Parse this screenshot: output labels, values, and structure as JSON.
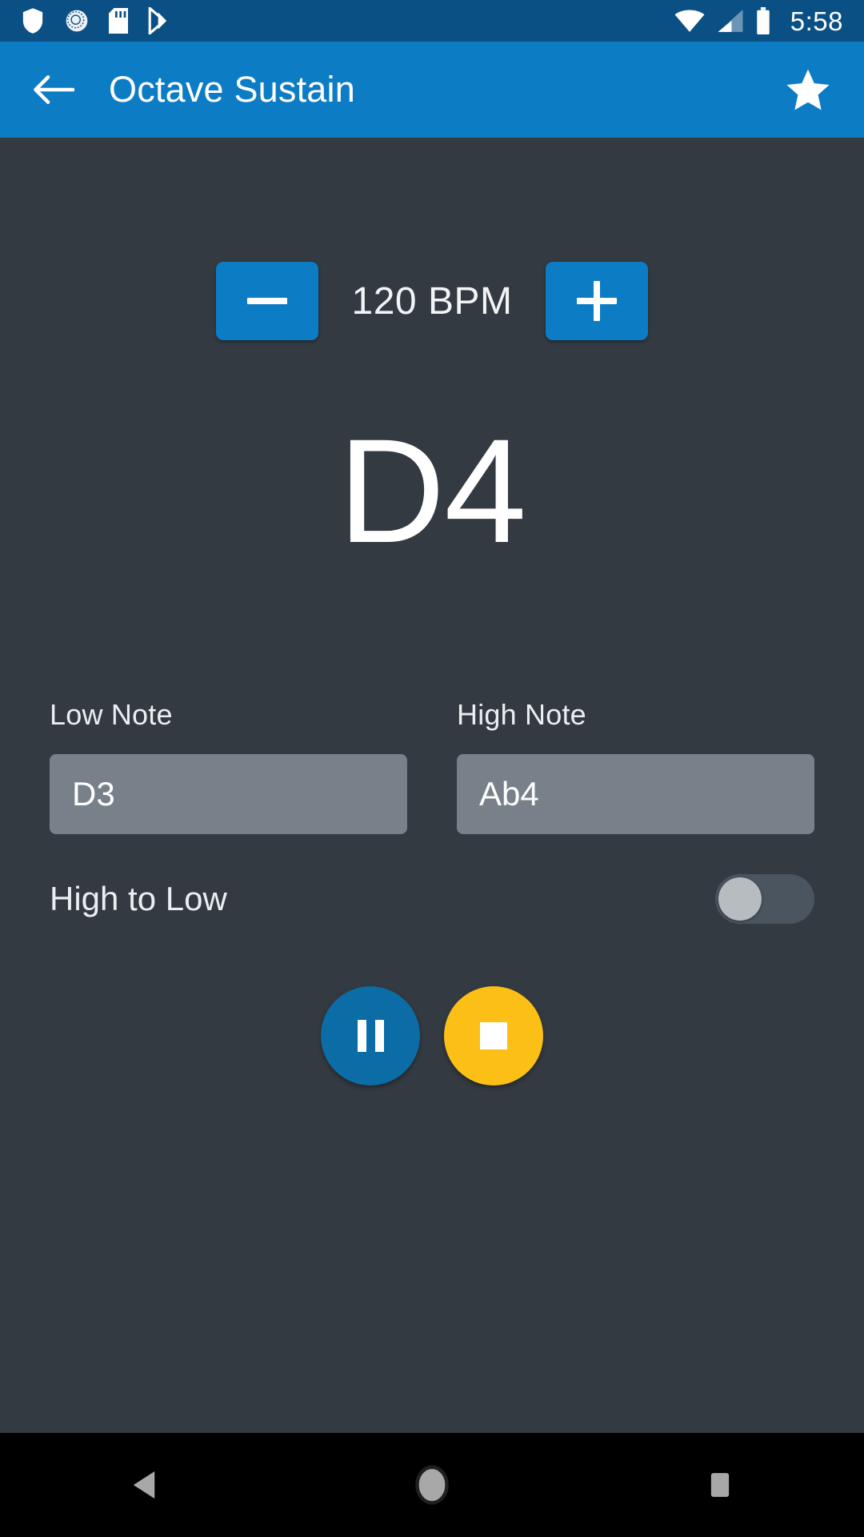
{
  "status_bar": {
    "background": "#0b5084",
    "time": "5:58",
    "icons": [
      {
        "name": "shield-icon"
      },
      {
        "name": "sync-circle-icon"
      },
      {
        "name": "sd-card-icon"
      },
      {
        "name": "play-store-icon"
      }
    ],
    "right_icons": [
      {
        "name": "wifi-icon"
      },
      {
        "name": "cellular-signal-icon"
      },
      {
        "name": "battery-icon"
      }
    ]
  },
  "app_bar": {
    "background": "#0c7cc4",
    "back_icon": "back-arrow-icon",
    "title": "Octave Sustain",
    "favorite_icon": "star-icon"
  },
  "main": {
    "background": "#343a42",
    "tempo": {
      "decrease_label": "−",
      "value_label": "120 BPM",
      "bpm": 120,
      "increase_label": "+",
      "button_color": "#0c7cc4"
    },
    "current_note": "D4",
    "range": {
      "low": {
        "label": "Low Note",
        "value": "D3"
      },
      "high": {
        "label": "High Note",
        "value": "Ab4"
      },
      "field_color": "#78818a"
    },
    "direction_toggle": {
      "label": "High to Low",
      "state": "off",
      "track_color": "#4a555f",
      "knob_color": "#b7bcc1"
    },
    "transport": {
      "pause_label": "pause-button",
      "pause_color": "#0b6ca6",
      "stop_label": "stop-button",
      "stop_color": "#fcbf16"
    }
  },
  "nav_bar": {
    "background": "#000000",
    "buttons": [
      {
        "name": "nav-back-button"
      },
      {
        "name": "nav-home-button"
      },
      {
        "name": "nav-recents-button"
      }
    ]
  }
}
